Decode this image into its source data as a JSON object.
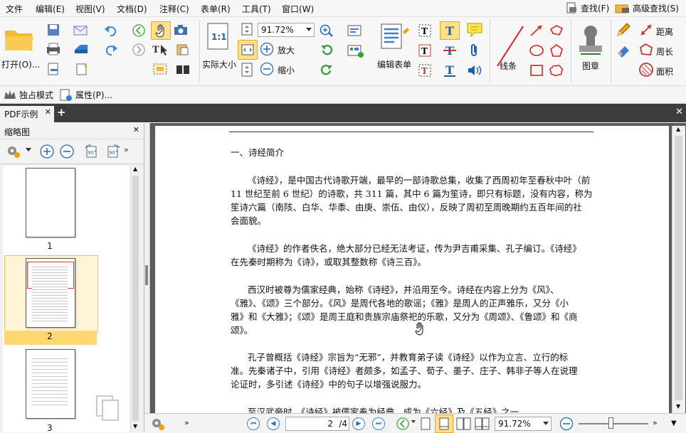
{
  "menu": [
    "文件",
    "编辑(E)",
    "视图(V)",
    "文档(D)",
    "注释(C)",
    "表单(R)",
    "工具(T)",
    "窗口(W)"
  ],
  "search": {
    "find": "查找(F)",
    "advanced": "高级查找(S)"
  },
  "ribbon": {
    "open_label": "打开(O)...",
    "actual_size": "实际大小",
    "zoom_value": "91.72%",
    "zoom_in": "放大",
    "zoom_out": "缩小",
    "edit_form": "编辑表单",
    "lines": "线条",
    "stamp": "图章",
    "distance": "距离",
    "perimeter": "周长",
    "area": "面积"
  },
  "subbar": {
    "exclusive": "独占模式",
    "properties": "属性(P)..."
  },
  "tab": {
    "title": "PDF示例"
  },
  "panel": {
    "title": "缩略图",
    "thumbnails": [
      {
        "number": "1",
        "selected": false
      },
      {
        "number": "2",
        "selected": true
      },
      {
        "number": "3",
        "selected": false
      }
    ]
  },
  "document": {
    "heading": "一、诗经简介",
    "lines": [
      "《诗经》，是中国古代诗歌开端，最早的一部诗歌总集，收集了西周初年至春秋中叶（前",
      "11 世纪至前 6 世纪）的诗歌，共 311 篇，其中 6 篇为笙诗，即只有标题，没有内容，称为",
      "笙诗六篇（南陔、白华、华黍、由庚、崇伍、由仪），反映了周初至周晚期约五百年间的社",
      "会面貌。",
      "《诗经》的作者佚名，绝大部分已经无法考证，传为尹吉甫采集、孔子编订。《诗经》",
      "在先秦时期称为《诗》，或取其整数称《诗三百》。",
      "西汉时被尊为儒家经典，始称《诗经》，并沿用至今。诗经在内容上分为《风》、",
      "《雅》、《颂》三个部分。《风》是周代各地的歌谣；《雅》是周人的正声雅乐，又分《小",
      "雅》和《大雅》；《颂》是周王庭和贵族宗庙祭祀的乐歌，又分为《周颂》、《鲁颂》和《商",
      "颂》。",
      "孔子曾概括《诗经》宗旨为“无邪”，并教育弟子读《诗经》以作为立言、立行的标",
      "准。先秦诸子中，引用《诗经》者颇多，如孟子、荀子、墨子、庄子、韩非子等人在说理",
      "论证时，多引述《诗经》中的句子以增强说服力。",
      "至汉武帝时，《诗经》被儒家奉为经典，成为《六经》及《五经》之一。"
    ]
  },
  "status": {
    "page_current": "2",
    "page_total": "/4",
    "zoom": "91.72%"
  }
}
